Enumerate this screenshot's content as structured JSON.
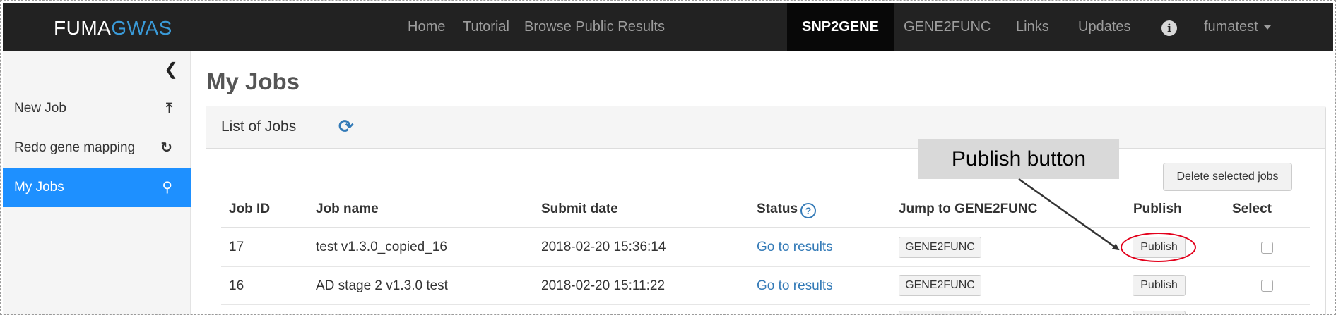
{
  "navbar": {
    "brand_part1": "FUMA",
    "brand_part2": "GWAS",
    "items": [
      "Home",
      "Tutorial",
      "Browse Public Results",
      "SNP2GENE",
      "GENE2FUNC",
      "Links",
      "Updates"
    ],
    "active_item": "SNP2GENE",
    "info_glyph": "i",
    "user": "fumatest"
  },
  "sidebar": {
    "collapse_glyph": "❮",
    "items": [
      {
        "label": "New Job",
        "icon": "upload-icon",
        "glyph": "⤒"
      },
      {
        "label": "Redo gene mapping",
        "icon": "refresh-icon",
        "glyph": "↻"
      },
      {
        "label": "My Jobs",
        "icon": "search-icon",
        "glyph": "⚲"
      }
    ],
    "active_index": 2
  },
  "main": {
    "title": "My Jobs",
    "panel_title": "List of Jobs",
    "refresh_glyph": "⟳",
    "delete_button": "Delete selected jobs",
    "columns": [
      "Job ID",
      "Job name",
      "Submit date",
      "Status",
      "Jump to GENE2FUNC",
      "Publish",
      "Select"
    ],
    "status_help_glyph": "?",
    "rows": [
      {
        "id": "17",
        "name": "test v1.3.0_copied_16",
        "date": "2018-02-20 15:36:14",
        "status": "Go to results",
        "gene2func": "GENE2FUNC",
        "publish": "Publish"
      },
      {
        "id": "16",
        "name": "AD stage 2 v1.3.0 test",
        "date": "2018-02-20 15:11:22",
        "status": "Go to results",
        "gene2func": "GENE2FUNC",
        "publish": "Publish"
      }
    ]
  },
  "annotation": {
    "callout_text": "Publish button",
    "highlight_color": "#e3001b"
  },
  "colors": {
    "navbar_bg": "#222222",
    "brand_accent": "#3a9bd9",
    "sidebar_active": "#1e90ff",
    "link": "#337ab7"
  }
}
